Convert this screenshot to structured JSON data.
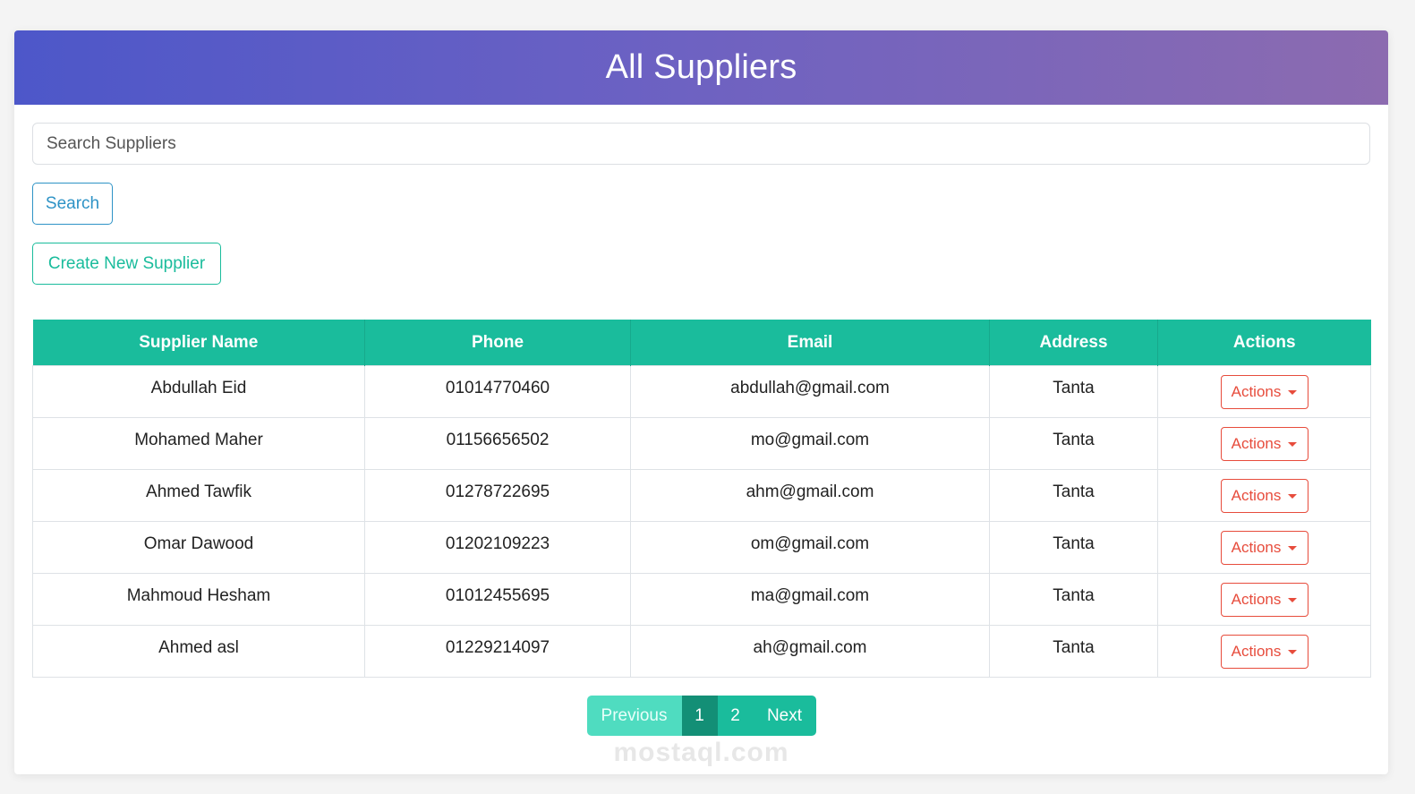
{
  "header": {
    "title": "All Suppliers"
  },
  "search": {
    "placeholder": "Search Suppliers",
    "value": "",
    "button_label": "Search"
  },
  "create_button_label": "Create New Supplier",
  "table": {
    "columns": [
      "Supplier Name",
      "Phone",
      "Email",
      "Address",
      "Actions"
    ],
    "action_label": "Actions",
    "rows": [
      {
        "name": "Abdullah Eid",
        "phone": "01014770460",
        "email": "abdullah@gmail.com",
        "address": "Tanta"
      },
      {
        "name": "Mohamed Maher",
        "phone": "01156656502",
        "email": "mo@gmail.com",
        "address": "Tanta"
      },
      {
        "name": "Ahmed Tawfik",
        "phone": "01278722695",
        "email": "ahm@gmail.com",
        "address": "Tanta"
      },
      {
        "name": "Omar Dawood",
        "phone": "01202109223",
        "email": "om@gmail.com",
        "address": "Tanta"
      },
      {
        "name": "Mahmoud Hesham",
        "phone": "01012455695",
        "email": "ma@gmail.com",
        "address": "Tanta"
      },
      {
        "name": "Ahmed asl",
        "phone": "01229214097",
        "email": "ah@gmail.com",
        "address": "Tanta"
      }
    ]
  },
  "pagination": {
    "previous_label": "Previous",
    "pages": [
      "1",
      "2"
    ],
    "current_page": "1",
    "next_label": "Next"
  },
  "watermark": "mostaql.com",
  "colors": {
    "accent": "#1abc9c",
    "search_button": "#2e93c6",
    "actions_button": "#e74c3c",
    "header_gradient_start": "#4d57c9",
    "header_gradient_end": "#8c6bb0"
  }
}
